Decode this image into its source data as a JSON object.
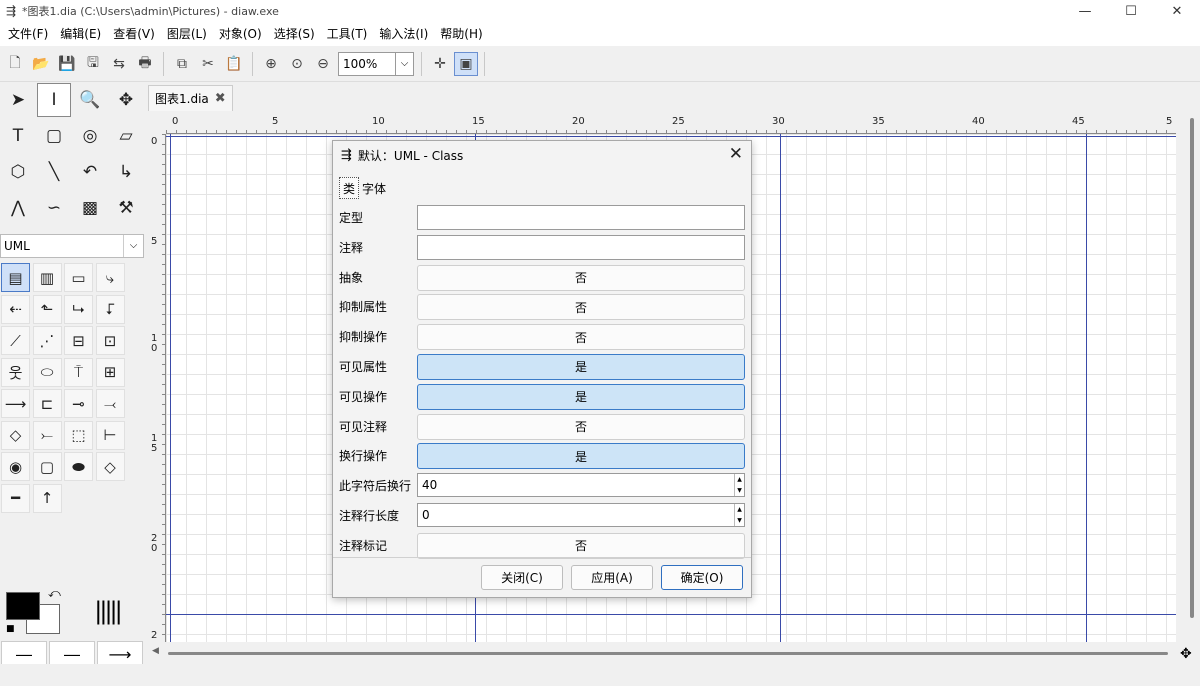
{
  "window": {
    "title": "*图表1.dia (C:\\Users\\admin\\Pictures) - diaw.exe",
    "minimize": "—",
    "maximize": "☐",
    "close": "✕"
  },
  "menu": [
    "文件(F)",
    "编辑(E)",
    "查看(V)",
    "图层(L)",
    "对象(O)",
    "选择(S)",
    "工具(T)",
    "输入法(I)",
    "帮助(H)"
  ],
  "toolbar": {
    "zoom_value": "100%"
  },
  "toolbox": {
    "sheet_value": "UML"
  },
  "tab": {
    "label": "图表1.dia",
    "close": "✖"
  },
  "ruler": {
    "h": [
      "0",
      "5",
      "10",
      "15",
      "20",
      "25",
      "30",
      "35",
      "40",
      "45",
      "5"
    ],
    "v": [
      "0",
      "5",
      "1\n0",
      "1\n5",
      "2\n0",
      "2"
    ]
  },
  "dialog": {
    "title": "默认：UML - Class",
    "tabs": [
      "类",
      "字体"
    ],
    "rows": {
      "stereotype": {
        "label": "定型",
        "value": ""
      },
      "comment": {
        "label": "注释",
        "value": ""
      },
      "abstract": {
        "label": "抽象",
        "value": "否"
      },
      "suppress_attributes": {
        "label": "抑制属性",
        "value": "否"
      },
      "suppress_operations": {
        "label": "抑制操作",
        "value": "否"
      },
      "visible_attributes": {
        "label": "可见属性",
        "value": "是"
      },
      "visible_operations": {
        "label": "可见操作",
        "value": "是"
      },
      "visible_comments": {
        "label": "可见注释",
        "value": "否"
      },
      "wrap_operations": {
        "label": "换行操作",
        "value": "是"
      },
      "wrap_after_char": {
        "label": "此字符后换行",
        "value": "40"
      },
      "comment_line_length": {
        "label": "注释行长度",
        "value": "0"
      },
      "comment_tagging": {
        "label": "注释标记",
        "value": "否"
      }
    },
    "buttons": {
      "close": "关闭(C)",
      "apply": "应用(A)",
      "ok": "确定(O)"
    }
  }
}
